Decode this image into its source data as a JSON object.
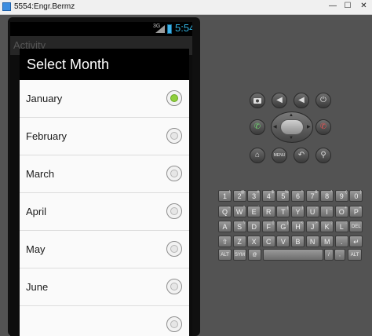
{
  "window": {
    "title": "5554:Engr.Bermz",
    "min_label": "—",
    "max_label": "☐",
    "close_label": "✕"
  },
  "status_bar": {
    "network": "3G",
    "time": "5:54"
  },
  "action_bar": {
    "title": "Activity"
  },
  "dialog": {
    "title": "Select Month",
    "selected": "January",
    "months": [
      {
        "label": "January",
        "checked": true
      },
      {
        "label": "February",
        "checked": false
      },
      {
        "label": "March",
        "checked": false
      },
      {
        "label": "April",
        "checked": false
      },
      {
        "label": "May",
        "checked": false
      },
      {
        "label": "June",
        "checked": false
      },
      {
        "label": "",
        "checked": false
      }
    ]
  },
  "controls": {
    "menu_label": "MENU"
  },
  "keyboard": {
    "row1": [
      {
        "k": "1",
        "s": "!"
      },
      {
        "k": "2",
        "s": "@"
      },
      {
        "k": "3",
        "s": "#"
      },
      {
        "k": "4",
        "s": "$"
      },
      {
        "k": "5",
        "s": "%"
      },
      {
        "k": "6",
        "s": "^"
      },
      {
        "k": "7",
        "s": "&"
      },
      {
        "k": "8",
        "s": "*"
      },
      {
        "k": "9",
        "s": "("
      },
      {
        "k": "0",
        "s": ")"
      }
    ],
    "row2": [
      {
        "k": "Q",
        "s": "~"
      },
      {
        "k": "W",
        "s": "\""
      },
      {
        "k": "E",
        "s": "´"
      },
      {
        "k": "R",
        "s": ""
      },
      {
        "k": "T",
        "s": "{"
      },
      {
        "k": "Y",
        "s": "}"
      },
      {
        "k": "U",
        "s": "-"
      },
      {
        "k": "I",
        "s": "_"
      },
      {
        "k": "O",
        "s": "+"
      },
      {
        "k": "P",
        "s": "="
      }
    ],
    "row3": [
      {
        "k": "A",
        "s": ""
      },
      {
        "k": "S",
        "s": "\\"
      },
      {
        "k": "D",
        "s": ""
      },
      {
        "k": "F",
        "s": "["
      },
      {
        "k": "G",
        "s": "]"
      },
      {
        "k": "H",
        "s": "<"
      },
      {
        "k": "J",
        "s": ">"
      },
      {
        "k": "K",
        "s": ";"
      },
      {
        "k": "L",
        "s": ":"
      },
      {
        "k": "DEL",
        "s": ""
      }
    ],
    "row4": [
      {
        "k": "⇧",
        "s": ""
      },
      {
        "k": "Z",
        "s": ""
      },
      {
        "k": "X",
        "s": ""
      },
      {
        "k": "C",
        "s": ""
      },
      {
        "k": "V",
        "s": ""
      },
      {
        "k": "B",
        "s": ""
      },
      {
        "k": "N",
        "s": ""
      },
      {
        "k": "M",
        "s": ""
      },
      {
        "k": ".",
        "s": ""
      },
      {
        "k": "↵",
        "s": ""
      }
    ],
    "row5": {
      "alt_left": "ALT",
      "sym": "SYM",
      "at": "@",
      "space": "",
      "slash": "/",
      "comma": ",",
      "alt_right": "ALT"
    }
  }
}
